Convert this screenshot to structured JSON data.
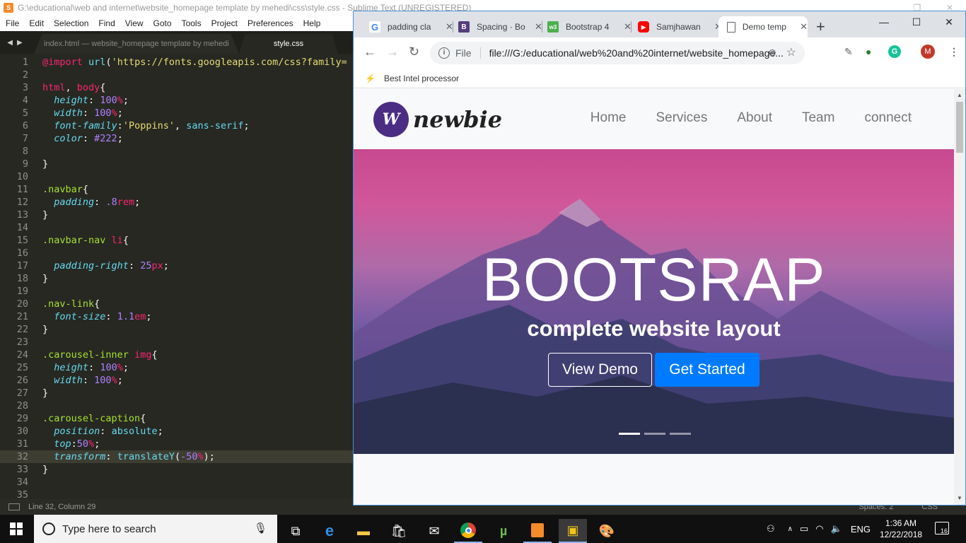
{
  "sublime": {
    "title": "G:\\educational\\web and internet\\website_homepage template by mehedi\\css\\style.css - Sublime Text (UNREGISTERED)",
    "menu": [
      "File",
      "Edit",
      "Selection",
      "Find",
      "View",
      "Goto",
      "Tools",
      "Project",
      "Preferences",
      "Help"
    ],
    "tabs": [
      {
        "label": "index.html — website_homepage template by mehedi",
        "active": false
      },
      {
        "label": "style.css",
        "active": true
      }
    ],
    "status_left": "Line 32, Column 29",
    "status_spaces": "Spaces: 2",
    "status_syntax": "CSS",
    "current_line": 32
  },
  "code_lines": [
    [
      [
        "k",
        "@import"
      ],
      [
        "w",
        " "
      ],
      [
        "f",
        "url"
      ],
      [
        "w",
        "("
      ],
      [
        "s",
        "'https://fonts.googleapis.com/css?family="
      ]
    ],
    [],
    [
      [
        "k",
        "html"
      ],
      [
        "w",
        ", "
      ],
      [
        "k",
        "body"
      ],
      [
        "w",
        "{"
      ]
    ],
    [
      [
        "w",
        "  "
      ],
      [
        "p",
        "height"
      ],
      [
        "w",
        ": "
      ],
      [
        "n",
        "100"
      ],
      [
        "k",
        "%"
      ],
      [
        "w",
        ";"
      ]
    ],
    [
      [
        "w",
        "  "
      ],
      [
        "p",
        "width"
      ],
      [
        "w",
        ": "
      ],
      [
        "n",
        "100"
      ],
      [
        "k",
        "%"
      ],
      [
        "w",
        ";"
      ]
    ],
    [
      [
        "w",
        "  "
      ],
      [
        "p",
        "font-family"
      ],
      [
        "w",
        ":"
      ],
      [
        "s",
        "'Poppins'"
      ],
      [
        "w",
        ", "
      ],
      [
        "f",
        "sans-serif"
      ],
      [
        "w",
        ";"
      ]
    ],
    [
      [
        "w",
        "  "
      ],
      [
        "p",
        "color"
      ],
      [
        "w",
        ": "
      ],
      [
        "n",
        "#222"
      ],
      [
        "w",
        ";"
      ]
    ],
    [],
    [
      [
        "w",
        "}"
      ]
    ],
    [],
    [
      [
        "c",
        ".navbar"
      ],
      [
        "w",
        "{"
      ]
    ],
    [
      [
        "w",
        "  "
      ],
      [
        "p",
        "padding"
      ],
      [
        "w",
        ": "
      ],
      [
        "n",
        ".8"
      ],
      [
        "k",
        "rem"
      ],
      [
        "w",
        ";"
      ]
    ],
    [
      [
        "w",
        "}"
      ]
    ],
    [],
    [
      [
        "c",
        ".navbar-nav"
      ],
      [
        "w",
        " "
      ],
      [
        "k",
        "li"
      ],
      [
        "w",
        "{"
      ]
    ],
    [],
    [
      [
        "w",
        "  "
      ],
      [
        "p",
        "padding-right"
      ],
      [
        "w",
        ": "
      ],
      [
        "n",
        "25"
      ],
      [
        "k",
        "px"
      ],
      [
        "w",
        ";"
      ]
    ],
    [
      [
        "w",
        "}"
      ]
    ],
    [],
    [
      [
        "c",
        ".nav-link"
      ],
      [
        "w",
        "{"
      ]
    ],
    [
      [
        "w",
        "  "
      ],
      [
        "p",
        "font-size"
      ],
      [
        "w",
        ": "
      ],
      [
        "n",
        "1.1"
      ],
      [
        "k",
        "em"
      ],
      [
        "w",
        ";"
      ]
    ],
    [
      [
        "w",
        "}"
      ]
    ],
    [],
    [
      [
        "c",
        ".carousel-inner"
      ],
      [
        "w",
        " "
      ],
      [
        "k",
        "img"
      ],
      [
        "w",
        "{"
      ]
    ],
    [
      [
        "w",
        "  "
      ],
      [
        "p",
        "height"
      ],
      [
        "w",
        ": "
      ],
      [
        "n",
        "100"
      ],
      [
        "k",
        "%"
      ],
      [
        "w",
        ";"
      ]
    ],
    [
      [
        "w",
        "  "
      ],
      [
        "p",
        "width"
      ],
      [
        "w",
        ": "
      ],
      [
        "n",
        "100"
      ],
      [
        "k",
        "%"
      ],
      [
        "w",
        ";"
      ]
    ],
    [
      [
        "w",
        "}"
      ]
    ],
    [],
    [
      [
        "c",
        ".carousel-caption"
      ],
      [
        "w",
        "{"
      ]
    ],
    [
      [
        "w",
        "  "
      ],
      [
        "p",
        "position"
      ],
      [
        "w",
        ": "
      ],
      [
        "f",
        "absolute"
      ],
      [
        "w",
        ";"
      ]
    ],
    [
      [
        "w",
        "  "
      ],
      [
        "p",
        "top"
      ],
      [
        "w",
        ":"
      ],
      [
        "n",
        "50"
      ],
      [
        "k",
        "%"
      ],
      [
        "w",
        ";"
      ]
    ],
    [
      [
        "w",
        "  "
      ],
      [
        "p",
        "transform"
      ],
      [
        "w",
        ": "
      ],
      [
        "f",
        "translateY"
      ],
      [
        "w",
        "("
      ],
      [
        "n",
        "-50"
      ],
      [
        "k",
        "%"
      ],
      [
        "w",
        ");"
      ]
    ],
    [
      [
        "w",
        "}"
      ]
    ],
    [],
    []
  ],
  "chrome": {
    "tabs": [
      {
        "title": "padding cla",
        "favicon": "google-icon",
        "color": "#4285f4",
        "glyph": "G"
      },
      {
        "title": "Spacing · Bo",
        "favicon": "bootstrap-icon",
        "color": "#563d7c",
        "glyph": "B"
      },
      {
        "title": "Bootstrap 4",
        "favicon": "w3schools-icon",
        "color": "#4caf50",
        "glyph": "w3"
      },
      {
        "title": "Samjhawan",
        "favicon": "youtube-icon",
        "color": "#ff0000",
        "glyph": "▶"
      },
      {
        "title": "Demo temp",
        "favicon": "page-icon",
        "color": "#ffffff",
        "glyph": "",
        "active": true
      }
    ],
    "address_label": "File",
    "url": "file:///G:/educational/web%20and%20internet/website_homepage...",
    "bookmark": "Best Intel processor",
    "profile_initial": "M"
  },
  "site": {
    "brand_mark": "W",
    "brand_word": "newbie",
    "nav": [
      "Home",
      "Services",
      "About",
      "Team",
      "connect"
    ],
    "hero_title": "BOOTSRAP",
    "hero_subtitle": "complete website layout",
    "btn_demo": "View Demo",
    "btn_start": "Get Started",
    "slides": 3,
    "active_slide": 0,
    "primary_color": "#007bff"
  },
  "taskbar": {
    "search_placeholder": "Type here to search",
    "language": "ENG",
    "time": "1:36 AM",
    "date": "12/22/2018",
    "notifications": "16"
  }
}
